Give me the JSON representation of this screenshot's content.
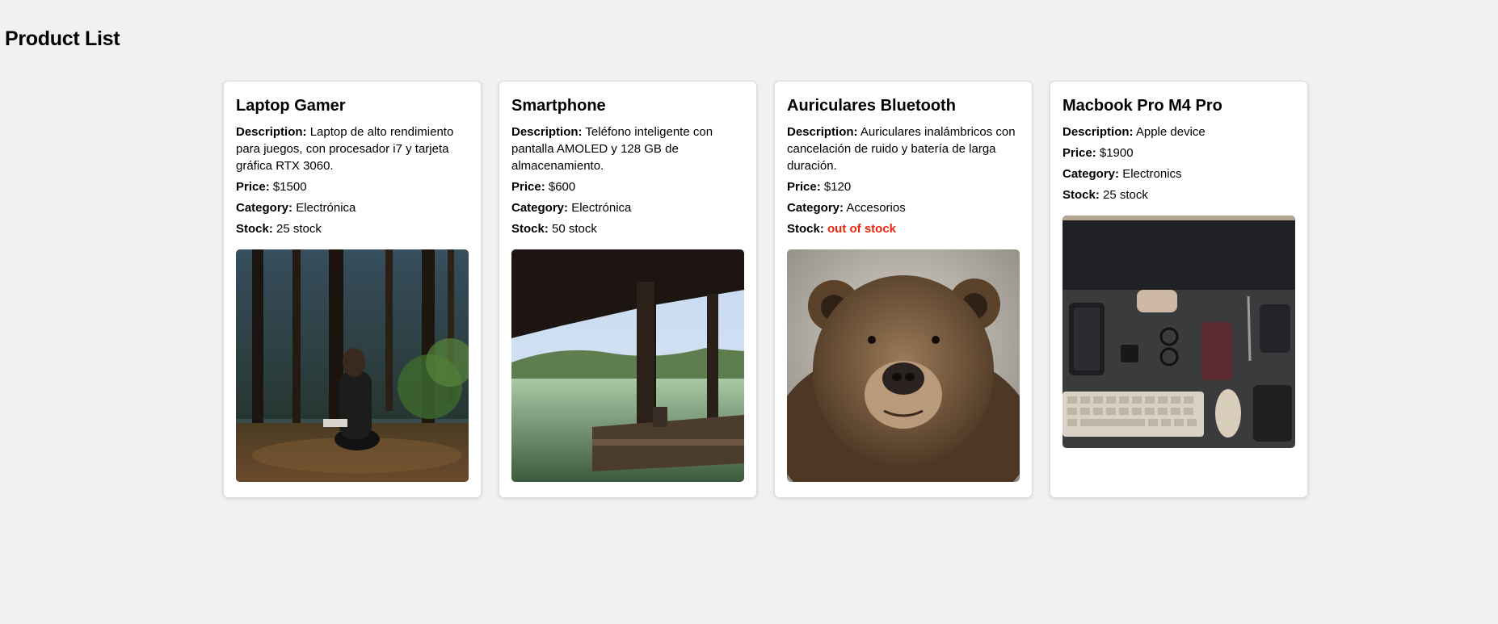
{
  "page": {
    "title": "Product List"
  },
  "labels": {
    "description": "Description:",
    "price": "Price:",
    "category": "Category:",
    "stock": "Stock:"
  },
  "products": [
    {
      "name": "Laptop Gamer",
      "description": "Laptop de alto rendimiento para juegos, con procesador i7 y tarjeta gráfica RTX 3060.",
      "price": "$1500",
      "category": "Electrónica",
      "stock": "25 stock",
      "image": "forest-person-photo"
    },
    {
      "name": "Smartphone",
      "description": "Teléfono inteligente con pantalla AMOLED y 128 GB de almacenamiento.",
      "price": "$600",
      "category": "Electrónica",
      "stock": "50 stock",
      "image": "lake-dock-photo"
    },
    {
      "name": "Auriculares Bluetooth",
      "description": "Auriculares inalámbricos con cancelación de ruido y batería de larga duración.",
      "price": "$120",
      "category": "Accesorios",
      "stock": "out of stock",
      "stock_color": "#e8250d",
      "image": "bear-photo"
    },
    {
      "name": "Macbook Pro M4 Pro",
      "description": "Apple device",
      "price": "$1900",
      "category": "Electronics",
      "stock": "25 stock",
      "image": "desk-setup-photo"
    }
  ]
}
